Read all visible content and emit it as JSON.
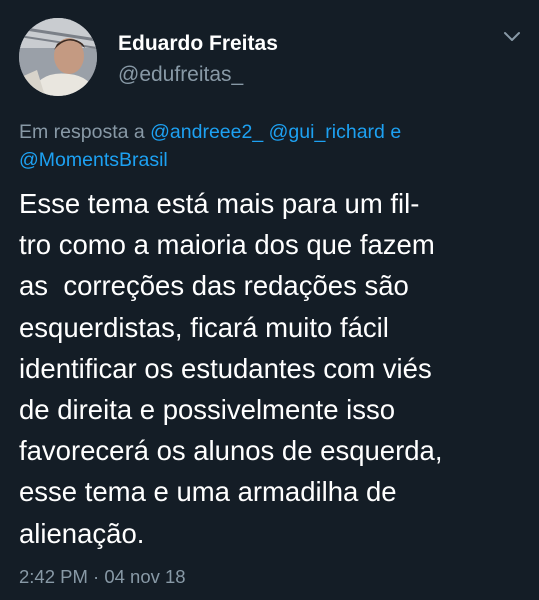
{
  "author": {
    "display_name": "Eduardo Freitas",
    "handle": "@edufreitas_"
  },
  "reply": {
    "prefix": "Em resposta a ",
    "mention_1": "@andreee2_",
    "space": " ",
    "mention_2": "@gui_richard",
    "conjunction": " e ",
    "mention_3": "@MomentsBrasil"
  },
  "tweet": {
    "lines": [
      "Esse tema está mais para um fil-",
      "tro como a maioria dos que fazem",
      "as  correções das redações são",
      "esquerdistas, ficará muito fácil",
      "identificar os estudantes com viés",
      "de direita e possivelmente isso",
      "favorecerá os alunos de esquerda,",
      "esse tema e uma armadilha de",
      "alienação."
    ]
  },
  "meta": {
    "timestamp": "2:42 PM · 04 nov 18"
  },
  "icons": {
    "menu": "chevron-down-icon",
    "avatar": "user-avatar"
  },
  "colors": {
    "background": "#141d26",
    "text": "#ffffff",
    "muted": "#8899a6",
    "link": "#1da1f2"
  }
}
